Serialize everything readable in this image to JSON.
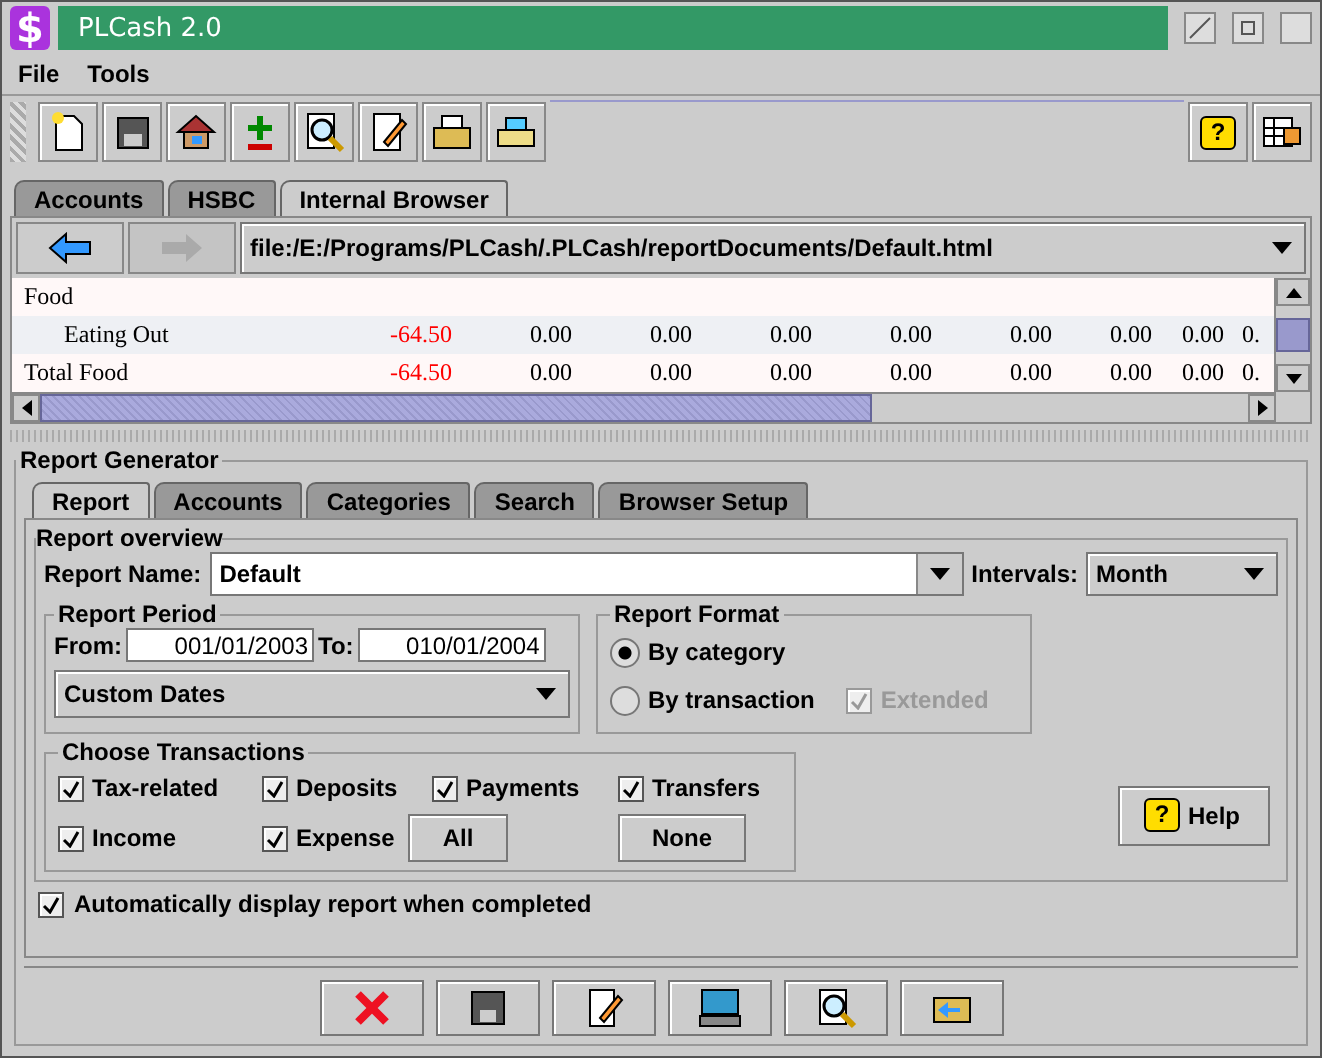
{
  "window": {
    "title": "PLCash 2.0",
    "app_icon": "$"
  },
  "menu": [
    "File",
    "Tools"
  ],
  "toolbar": {
    "help_icon": "?"
  },
  "main_tabs": [
    {
      "label": "Accounts",
      "selected": false
    },
    {
      "label": "HSBC",
      "selected": false
    },
    {
      "label": "Internal Browser",
      "selected": true
    }
  ],
  "browser": {
    "address": "file:/E:/Programs/PLCash/.PLCash/reportDocuments/Default.html",
    "rows": [
      {
        "kind": "group",
        "cells": [
          {
            "text": "Food",
            "negative": false
          }
        ]
      },
      {
        "kind": "item",
        "cells": [
          {
            "text": "Eating Out",
            "negative": false
          },
          {
            "text": "-64.50",
            "negative": true
          },
          {
            "text": "0.00",
            "negative": false
          },
          {
            "text": "0.00",
            "negative": false
          },
          {
            "text": "0.00",
            "negative": false
          },
          {
            "text": "0.00",
            "negative": false
          },
          {
            "text": "0.00",
            "negative": false
          },
          {
            "text": "0.00",
            "negative": false
          },
          {
            "text": "0.00",
            "negative": false
          },
          {
            "text": "0.",
            "negative": false
          }
        ]
      },
      {
        "kind": "total",
        "cells": [
          {
            "text": "Total Food",
            "negative": false
          },
          {
            "text": "-64.50",
            "negative": true
          },
          {
            "text": "0.00",
            "negative": false
          },
          {
            "text": "0.00",
            "negative": false
          },
          {
            "text": "0.00",
            "negative": false
          },
          {
            "text": "0.00",
            "negative": false
          },
          {
            "text": "0.00",
            "negative": false
          },
          {
            "text": "0.00",
            "negative": false
          },
          {
            "text": "0.00",
            "negative": false
          },
          {
            "text": "0.",
            "negative": false
          }
        ]
      }
    ]
  },
  "report_generator": {
    "title": "Report Generator",
    "tabs": [
      {
        "label": "Report",
        "selected": true
      },
      {
        "label": "Accounts",
        "selected": false
      },
      {
        "label": "Categories",
        "selected": false
      },
      {
        "label": "Search",
        "selected": false
      },
      {
        "label": "Browser Setup",
        "selected": false
      }
    ],
    "overview_title": "Report overview",
    "report_name_label": "Report Name:",
    "report_name": "Default",
    "intervals_label": "Intervals:",
    "intervals": "Month",
    "period": {
      "title": "Report Period",
      "from_label": "From:",
      "from": "001/01/2003",
      "to_label": "To:",
      "to": "010/01/2004",
      "range": "Custom Dates"
    },
    "format": {
      "title": "Report Format",
      "options": [
        {
          "label": "By category",
          "selected": true
        },
        {
          "label": "By transaction",
          "selected": false
        }
      ],
      "extended": {
        "label": "Extended",
        "checked": true,
        "disabled": true
      }
    },
    "transactions": {
      "title": "Choose Transactions",
      "options": [
        {
          "label": "Tax-related",
          "checked": true
        },
        {
          "label": "Deposits",
          "checked": true
        },
        {
          "label": "Payments",
          "checked": true
        },
        {
          "label": "Transfers",
          "checked": true
        },
        {
          "label": "Income",
          "checked": true
        },
        {
          "label": "Expense",
          "checked": true
        }
      ],
      "all_button": "All",
      "none_button": "None"
    },
    "help_icon": "?",
    "help_button": "Help",
    "auto_display": {
      "label": "Automatically display report when completed",
      "checked": true
    }
  }
}
